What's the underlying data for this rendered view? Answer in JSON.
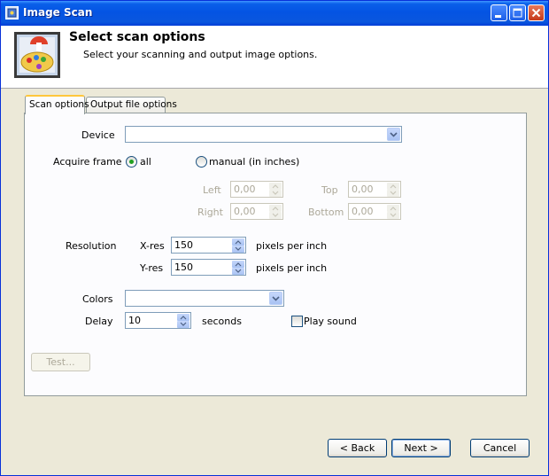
{
  "window": {
    "title": "Image Scan"
  },
  "header": {
    "title": "Select scan options",
    "subtitle": "Select your scanning and output image options."
  },
  "tabs": [
    {
      "label": "Scan options",
      "active": true
    },
    {
      "label": "Output file options",
      "active": false
    }
  ],
  "scan": {
    "device_label": "Device",
    "device_value": "",
    "acquire_label": "Acquire frame",
    "acquire_all": "all",
    "acquire_manual": "manual (in inches)",
    "left_label": "Left",
    "left_value": "0,00",
    "top_label": "Top",
    "top_value": "0,00",
    "right_label": "Right",
    "right_value": "0,00",
    "bottom_label": "Bottom",
    "bottom_value": "0,00",
    "resolution_label": "Resolution",
    "xres_label": "X-res",
    "xres_value": "150",
    "yres_label": "Y-res",
    "yres_value": "150",
    "ppi_label": "pixels per inch",
    "colors_label": "Colors",
    "colors_value": "",
    "delay_label": "Delay",
    "delay_value": "10",
    "delay_unit": "seconds",
    "play_sound_label": "Play sound",
    "test_button": "Test..."
  },
  "footer": {
    "back": "< Back",
    "next": "Next >",
    "cancel": "Cancel"
  },
  "colors": {
    "title_bar": "#0454e3",
    "accent_tab": "#ffc73c",
    "radio_dot": "#21a121"
  }
}
